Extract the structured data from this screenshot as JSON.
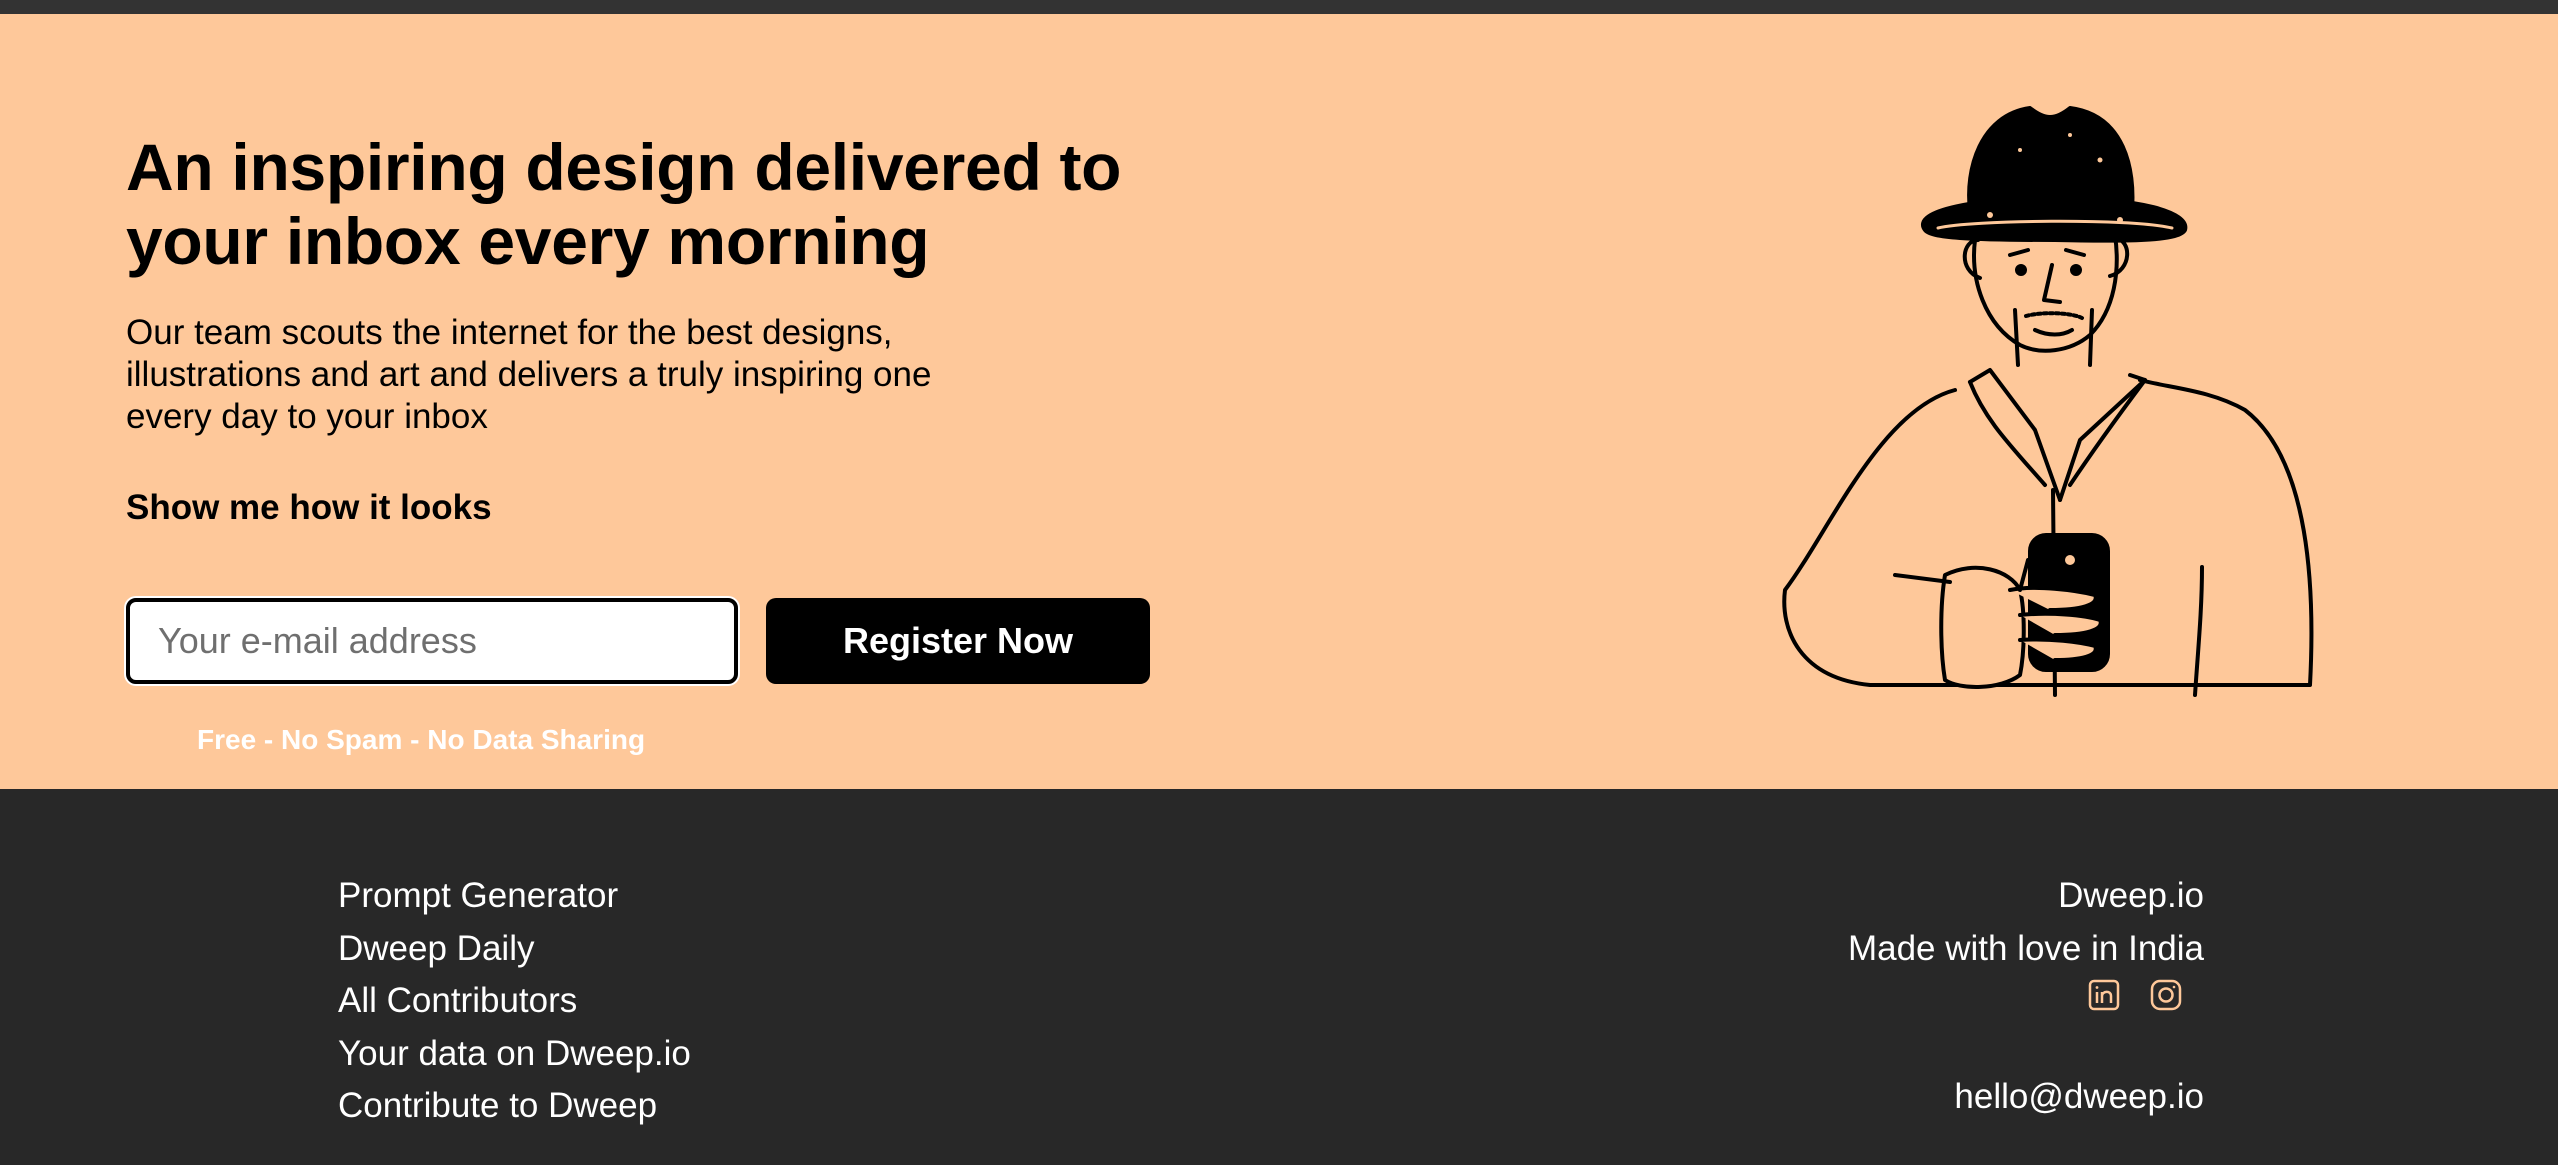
{
  "hero": {
    "headline_line1": "An inspiring design delivered to",
    "headline_line2": "your inbox every morning",
    "description_line1": "Our team scouts the internet for the best designs,",
    "description_line2": "illustrations and art and delivers a truly inspiring one",
    "description_line3": "every day to your inbox",
    "show_link": "Show me how it looks",
    "email_placeholder": "Your e-mail address",
    "email_value": "",
    "register_label": "Register Now",
    "free_note": "Free - No Spam - No Data Sharing"
  },
  "footer": {
    "links": [
      "Prompt Generator",
      "Dweep Daily",
      "All Contributors",
      "Your data on Dweep.io",
      "Contribute to Dweep"
    ],
    "brand": "Dweep.io",
    "tagline": "Made with love in India",
    "email": "hello@dweep.io",
    "social_icons": [
      "linkedin-icon",
      "instagram-icon"
    ]
  },
  "colors": {
    "hero_bg": "#fec89a",
    "footer_bg": "#282828",
    "button_bg": "#000000",
    "icon_accent": "#fec89a"
  }
}
